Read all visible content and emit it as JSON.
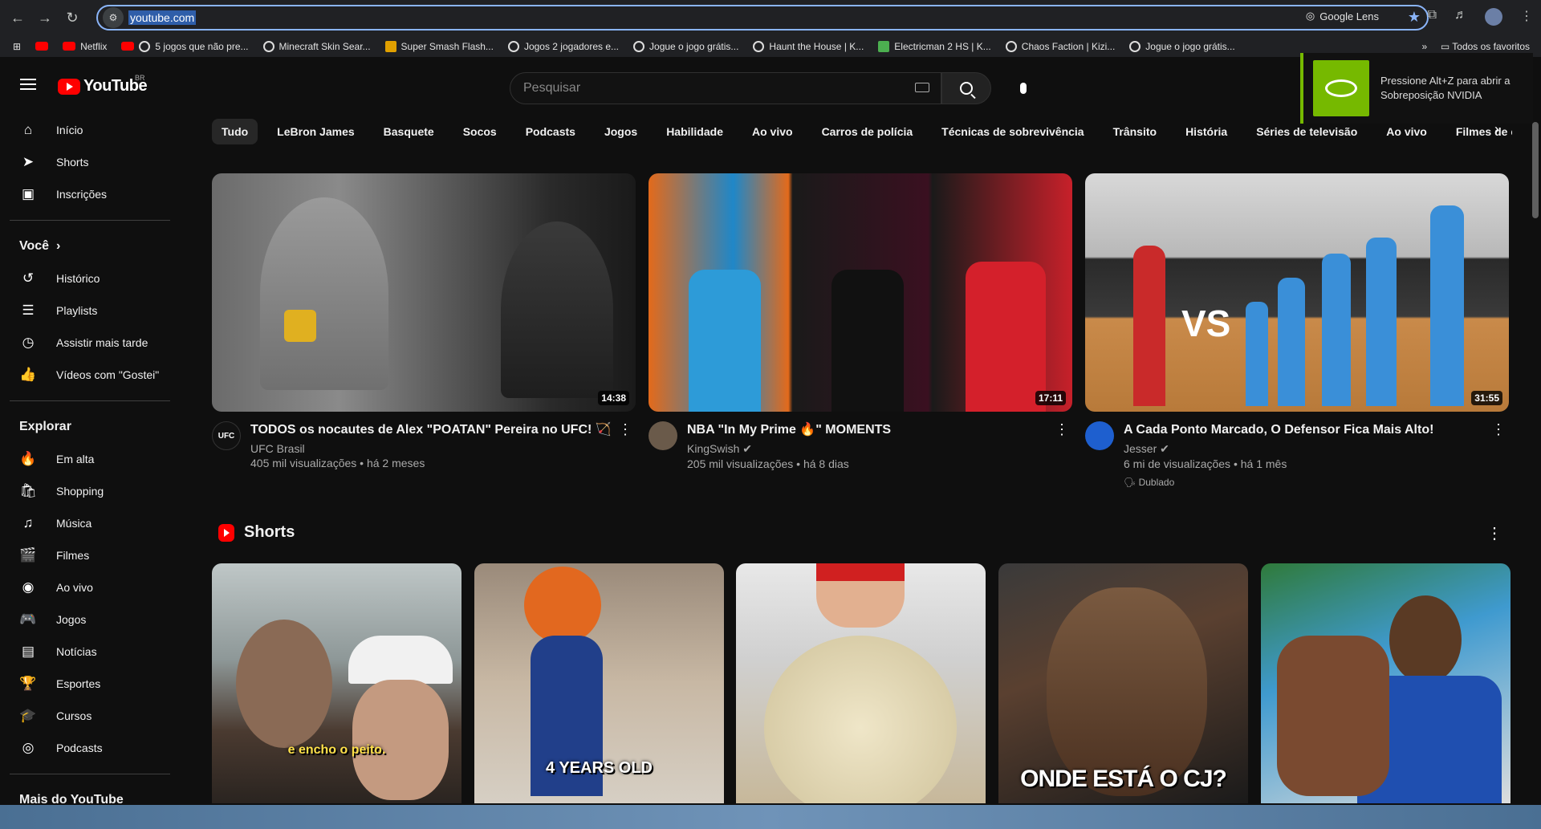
{
  "browser": {
    "url": "youtube.com",
    "lens_label": "Google Lens",
    "all_bookmarks": "Todos os favoritos",
    "bookmarks": [
      {
        "label": "Netflix",
        "icon": "red"
      },
      {
        "label": "5 jogos que não pre...",
        "icon": "ring"
      },
      {
        "label": "Minecraft Skin Sear...",
        "icon": "ring"
      },
      {
        "label": "Super Smash Flash...",
        "icon": "yel"
      },
      {
        "label": "Jogos 2 jogadores e...",
        "icon": "ring"
      },
      {
        "label": "Jogue o jogo grátis...",
        "icon": "ring"
      },
      {
        "label": "Haunt the House | K...",
        "icon": "ring"
      },
      {
        "label": "Electricman 2 HS | K...",
        "icon": "sq"
      },
      {
        "label": "Chaos Faction | Kizi...",
        "icon": "ring"
      },
      {
        "label": "Jogue o jogo grátis...",
        "icon": "ring"
      }
    ]
  },
  "youtube": {
    "logo_text": "YouTube",
    "region": "BR",
    "search_placeholder": "Pesquisar"
  },
  "nvidia": {
    "text": "Pressione Alt+Z para abrir a Sobreposição NVIDIA"
  },
  "sidebar": {
    "main": [
      {
        "label": "Início",
        "icon": "⌂"
      },
      {
        "label": "Shorts",
        "icon": "➤"
      },
      {
        "label": "Inscrições",
        "icon": "▣"
      }
    ],
    "you_heading": "Você",
    "you": [
      {
        "label": "Histórico",
        "icon": "↺"
      },
      {
        "label": "Playlists",
        "icon": "☰"
      },
      {
        "label": "Assistir mais tarde",
        "icon": "◷"
      },
      {
        "label": "Vídeos com \"Gostei\"",
        "icon": "👍"
      }
    ],
    "explore_heading": "Explorar",
    "explore": [
      {
        "label": "Em alta",
        "icon": "🔥"
      },
      {
        "label": "Shopping",
        "icon": "🛍"
      },
      {
        "label": "Música",
        "icon": "♫"
      },
      {
        "label": "Filmes",
        "icon": "🎬"
      },
      {
        "label": "Ao vivo",
        "icon": "◉"
      },
      {
        "label": "Jogos",
        "icon": "🎮"
      },
      {
        "label": "Notícias",
        "icon": "▤"
      },
      {
        "label": "Esportes",
        "icon": "🏆"
      },
      {
        "label": "Cursos",
        "icon": "🎓"
      },
      {
        "label": "Podcasts",
        "icon": "◎"
      }
    ],
    "more_heading": "Mais do YouTube"
  },
  "chips": [
    "Tudo",
    "LeBron James",
    "Basquete",
    "Socos",
    "Podcasts",
    "Jogos",
    "Habilidade",
    "Ao vivo",
    "Carros de polícia",
    "Técnicas de sobrevivência",
    "Trânsito",
    "História",
    "Séries de televisão",
    "Ao vivo",
    "Filmes de comédia"
  ],
  "videos": [
    {
      "title": "TODOS os nocautes de Alex \"POATAN\" Pereira no UFC! 🏹",
      "channel": "UFC Brasil",
      "stats": "405 mil visualizações • há 2 meses",
      "duration": "14:38",
      "badge": ""
    },
    {
      "title": "NBA \"In My Prime 🔥\" MOMENTS",
      "channel": "KingSwish ✔",
      "stats": "205 mil visualizações • há 8 dias",
      "duration": "17:11",
      "badge": ""
    },
    {
      "title": "A Cada Ponto Marcado, O Defensor Fica Mais Alto!",
      "channel": "Jesser ✔",
      "stats": "6 mi de visualizações • há 1 mês",
      "duration": "31:55",
      "badge": "Dublado"
    }
  ],
  "shorts_heading": "Shorts",
  "shorts": [
    {
      "caption": "e encho o peito."
    },
    {
      "caption": "4 YEARS OLD"
    },
    {
      "caption": ""
    },
    {
      "caption": "ONDE ESTÁ O CJ?"
    },
    {
      "caption": ""
    }
  ]
}
